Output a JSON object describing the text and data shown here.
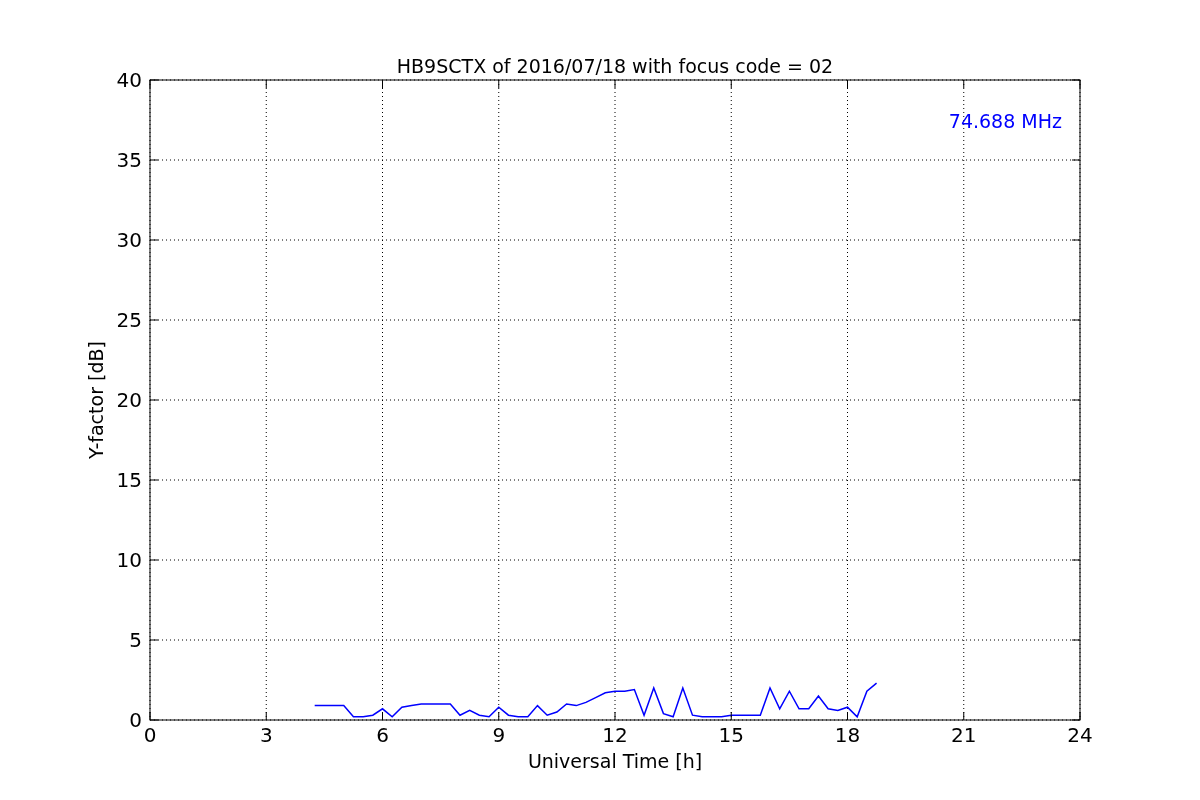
{
  "figure": {
    "chart_data": {
      "type": "line",
      "title": "HB9SCTX of 2016/07/18 with focus code = 02",
      "xlabel": "Universal Time [h]",
      "ylabel": "Y-factor [dB]",
      "xlim": [
        0,
        24
      ],
      "ylim": [
        0,
        40
      ],
      "xticks": [
        0,
        3,
        6,
        9,
        12,
        15,
        18,
        21,
        24
      ],
      "yticks": [
        0,
        5,
        10,
        15,
        20,
        25,
        30,
        35,
        40
      ],
      "x": [
        4.25,
        4.5,
        4.75,
        5.0,
        5.25,
        5.5,
        5.75,
        6.0,
        6.25,
        6.5,
        6.75,
        7.0,
        7.25,
        7.5,
        7.75,
        8.0,
        8.25,
        8.5,
        8.75,
        9.0,
        9.25,
        9.5,
        9.75,
        10.0,
        10.25,
        10.5,
        10.75,
        11.0,
        11.25,
        11.5,
        11.75,
        12.0,
        12.25,
        12.5,
        12.75,
        13.0,
        13.25,
        13.5,
        13.75,
        14.0,
        14.25,
        14.5,
        14.75,
        15.0,
        15.25,
        15.5,
        15.75,
        16.0,
        16.25,
        16.5,
        16.75,
        17.0,
        17.25,
        17.5,
        17.75,
        18.0,
        18.25,
        18.5,
        18.75
      ],
      "series": [
        {
          "name": "74.688 MHz",
          "color": "#0000ff",
          "values": [
            0.9,
            0.9,
            0.9,
            0.9,
            0.2,
            0.2,
            0.3,
            0.7,
            0.2,
            0.8,
            0.9,
            1.0,
            1.0,
            1.0,
            1.0,
            0.3,
            0.6,
            0.3,
            0.2,
            0.8,
            0.3,
            0.2,
            0.2,
            0.9,
            0.3,
            0.5,
            1.0,
            0.9,
            1.1,
            1.4,
            1.7,
            1.8,
            1.8,
            1.9,
            0.3,
            2.0,
            0.4,
            0.2,
            2.0,
            0.3,
            0.2,
            0.2,
            0.2,
            0.3,
            0.3,
            0.3,
            0.3,
            2.0,
            0.7,
            1.8,
            0.7,
            0.7,
            1.5,
            0.7,
            0.6,
            0.8,
            0.2,
            1.8,
            2.3
          ]
        }
      ],
      "grid": true
    }
  }
}
